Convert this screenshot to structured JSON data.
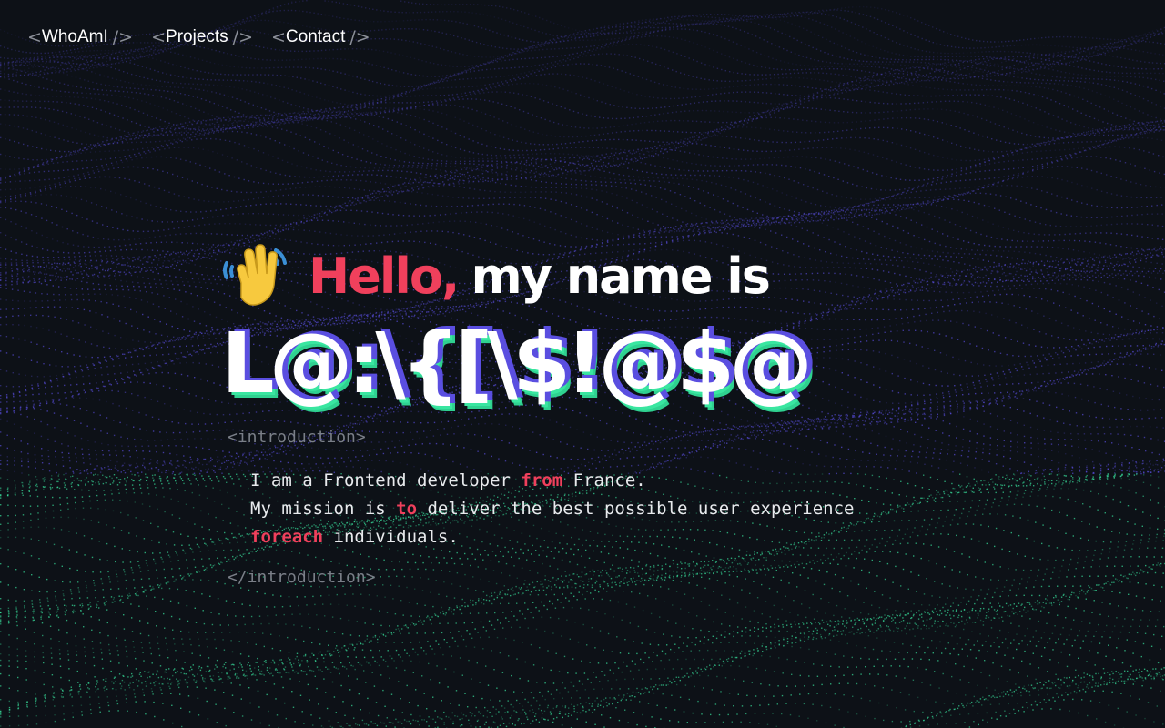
{
  "nav": {
    "open_bracket": "<",
    "close_bracket": "/>",
    "items": [
      {
        "label": "WhoAmI"
      },
      {
        "label": "Projects"
      },
      {
        "label": "Contact"
      }
    ]
  },
  "hero": {
    "wave_icon": "waving-hand-icon",
    "hello": "Hello,",
    "rest": "my name is",
    "name": "L@:\\{[\\$!@$@"
  },
  "intro": {
    "open_tag": "<introduction>",
    "close_tag": "</introduction>",
    "line1": {
      "a": "I am a Frontend developer ",
      "kw": "from",
      "b": " France."
    },
    "line2": {
      "a": "My mission is ",
      "kw": "to",
      "b": " deliver the best possible user experience"
    },
    "line3": {
      "kw": "foreach",
      "b": " individuals."
    }
  },
  "colors": {
    "background": "#0d1117",
    "accent_red": "#f0405c",
    "accent_green": "#39e6a0",
    "accent_purple": "#5a4ee0",
    "muted": "#7a7f88"
  }
}
